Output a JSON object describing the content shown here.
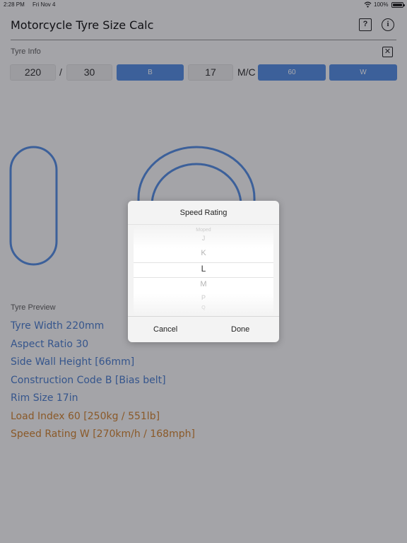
{
  "status_bar": {
    "time": "2:28 PM",
    "date": "Fri Nov 4",
    "battery": "100%"
  },
  "nav": {
    "title": "Motorcycle Tyre Size Calc",
    "help_glyph": "?",
    "info_glyph": "i"
  },
  "tyre_info": {
    "label": "Tyre Info",
    "width": "220",
    "separator": "/",
    "aspect": "30",
    "construction": "B",
    "rim": "17",
    "suffix": "M/C",
    "load_index": "60",
    "speed_rating": "W",
    "close_glyph": "✕"
  },
  "preview": {
    "label": "Tyre Preview",
    "lines": [
      {
        "text": "Tyre Width 220mm",
        "color": "#3e73c8"
      },
      {
        "text": "Aspect Ratio 30",
        "color": "#3e73c8"
      },
      {
        "text": "Side Wall Height [66mm]",
        "color": "#3e73c8"
      },
      {
        "text": "Construction Code B [Bias belt]",
        "color": "#3e73c8"
      },
      {
        "text": "Rim Size 17in",
        "color": "#3e73c8"
      },
      {
        "text": "Load Index 60 [250kg / 551lb]",
        "color": "#cc7a22"
      },
      {
        "text": "Speed Rating W [270km/h / 168mph]",
        "color": "#cc7a22"
      }
    ]
  },
  "picker": {
    "title": "Speed Rating",
    "options": [
      "Moped",
      "J",
      "K",
      "L",
      "M",
      "P",
      "Q"
    ],
    "selected": "L",
    "cancel_label": "Cancel",
    "done_label": "Done"
  },
  "colors": {
    "accent_blue": "#4a86e0",
    "text_blue": "#3e73c8",
    "text_orange": "#cc7a22"
  },
  "icons": [
    "wifi-icon",
    "battery-icon",
    "help-icon",
    "info-icon",
    "close-box-icon"
  ]
}
